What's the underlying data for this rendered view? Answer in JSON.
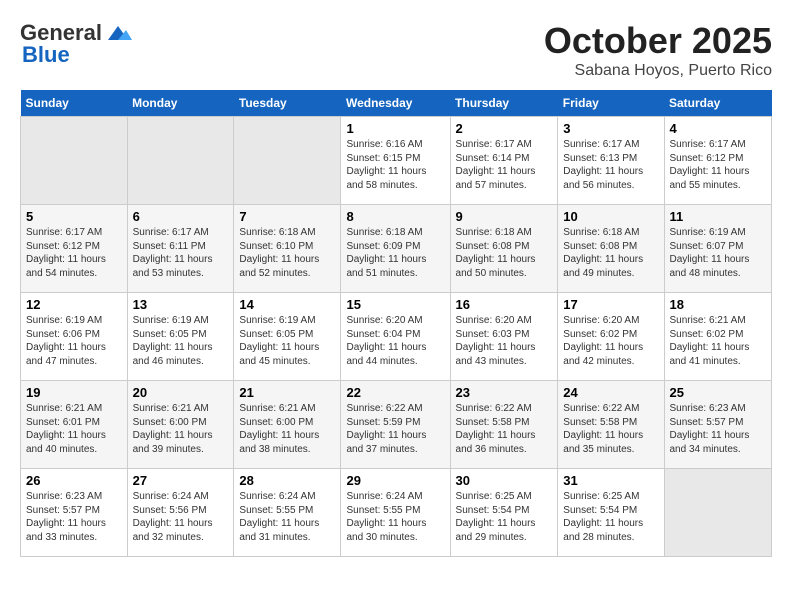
{
  "logo": {
    "general": "General",
    "blue": "Blue"
  },
  "header": {
    "month": "October 2025",
    "location": "Sabana Hoyos, Puerto Rico"
  },
  "weekdays": [
    "Sunday",
    "Monday",
    "Tuesday",
    "Wednesday",
    "Thursday",
    "Friday",
    "Saturday"
  ],
  "weeks": [
    [
      {
        "day": "",
        "info": ""
      },
      {
        "day": "",
        "info": ""
      },
      {
        "day": "",
        "info": ""
      },
      {
        "day": "1",
        "info": "Sunrise: 6:16 AM\nSunset: 6:15 PM\nDaylight: 11 hours\nand 58 minutes."
      },
      {
        "day": "2",
        "info": "Sunrise: 6:17 AM\nSunset: 6:14 PM\nDaylight: 11 hours\nand 57 minutes."
      },
      {
        "day": "3",
        "info": "Sunrise: 6:17 AM\nSunset: 6:13 PM\nDaylight: 11 hours\nand 56 minutes."
      },
      {
        "day": "4",
        "info": "Sunrise: 6:17 AM\nSunset: 6:12 PM\nDaylight: 11 hours\nand 55 minutes."
      }
    ],
    [
      {
        "day": "5",
        "info": "Sunrise: 6:17 AM\nSunset: 6:12 PM\nDaylight: 11 hours\nand 54 minutes."
      },
      {
        "day": "6",
        "info": "Sunrise: 6:17 AM\nSunset: 6:11 PM\nDaylight: 11 hours\nand 53 minutes."
      },
      {
        "day": "7",
        "info": "Sunrise: 6:18 AM\nSunset: 6:10 PM\nDaylight: 11 hours\nand 52 minutes."
      },
      {
        "day": "8",
        "info": "Sunrise: 6:18 AM\nSunset: 6:09 PM\nDaylight: 11 hours\nand 51 minutes."
      },
      {
        "day": "9",
        "info": "Sunrise: 6:18 AM\nSunset: 6:08 PM\nDaylight: 11 hours\nand 50 minutes."
      },
      {
        "day": "10",
        "info": "Sunrise: 6:18 AM\nSunset: 6:08 PM\nDaylight: 11 hours\nand 49 minutes."
      },
      {
        "day": "11",
        "info": "Sunrise: 6:19 AM\nSunset: 6:07 PM\nDaylight: 11 hours\nand 48 minutes."
      }
    ],
    [
      {
        "day": "12",
        "info": "Sunrise: 6:19 AM\nSunset: 6:06 PM\nDaylight: 11 hours\nand 47 minutes."
      },
      {
        "day": "13",
        "info": "Sunrise: 6:19 AM\nSunset: 6:05 PM\nDaylight: 11 hours\nand 46 minutes."
      },
      {
        "day": "14",
        "info": "Sunrise: 6:19 AM\nSunset: 6:05 PM\nDaylight: 11 hours\nand 45 minutes."
      },
      {
        "day": "15",
        "info": "Sunrise: 6:20 AM\nSunset: 6:04 PM\nDaylight: 11 hours\nand 44 minutes."
      },
      {
        "day": "16",
        "info": "Sunrise: 6:20 AM\nSunset: 6:03 PM\nDaylight: 11 hours\nand 43 minutes."
      },
      {
        "day": "17",
        "info": "Sunrise: 6:20 AM\nSunset: 6:02 PM\nDaylight: 11 hours\nand 42 minutes."
      },
      {
        "day": "18",
        "info": "Sunrise: 6:21 AM\nSunset: 6:02 PM\nDaylight: 11 hours\nand 41 minutes."
      }
    ],
    [
      {
        "day": "19",
        "info": "Sunrise: 6:21 AM\nSunset: 6:01 PM\nDaylight: 11 hours\nand 40 minutes."
      },
      {
        "day": "20",
        "info": "Sunrise: 6:21 AM\nSunset: 6:00 PM\nDaylight: 11 hours\nand 39 minutes."
      },
      {
        "day": "21",
        "info": "Sunrise: 6:21 AM\nSunset: 6:00 PM\nDaylight: 11 hours\nand 38 minutes."
      },
      {
        "day": "22",
        "info": "Sunrise: 6:22 AM\nSunset: 5:59 PM\nDaylight: 11 hours\nand 37 minutes."
      },
      {
        "day": "23",
        "info": "Sunrise: 6:22 AM\nSunset: 5:58 PM\nDaylight: 11 hours\nand 36 minutes."
      },
      {
        "day": "24",
        "info": "Sunrise: 6:22 AM\nSunset: 5:58 PM\nDaylight: 11 hours\nand 35 minutes."
      },
      {
        "day": "25",
        "info": "Sunrise: 6:23 AM\nSunset: 5:57 PM\nDaylight: 11 hours\nand 34 minutes."
      }
    ],
    [
      {
        "day": "26",
        "info": "Sunrise: 6:23 AM\nSunset: 5:57 PM\nDaylight: 11 hours\nand 33 minutes."
      },
      {
        "day": "27",
        "info": "Sunrise: 6:24 AM\nSunset: 5:56 PM\nDaylight: 11 hours\nand 32 minutes."
      },
      {
        "day": "28",
        "info": "Sunrise: 6:24 AM\nSunset: 5:55 PM\nDaylight: 11 hours\nand 31 minutes."
      },
      {
        "day": "29",
        "info": "Sunrise: 6:24 AM\nSunset: 5:55 PM\nDaylight: 11 hours\nand 30 minutes."
      },
      {
        "day": "30",
        "info": "Sunrise: 6:25 AM\nSunset: 5:54 PM\nDaylight: 11 hours\nand 29 minutes."
      },
      {
        "day": "31",
        "info": "Sunrise: 6:25 AM\nSunset: 5:54 PM\nDaylight: 11 hours\nand 28 minutes."
      },
      {
        "day": "",
        "info": ""
      }
    ]
  ]
}
